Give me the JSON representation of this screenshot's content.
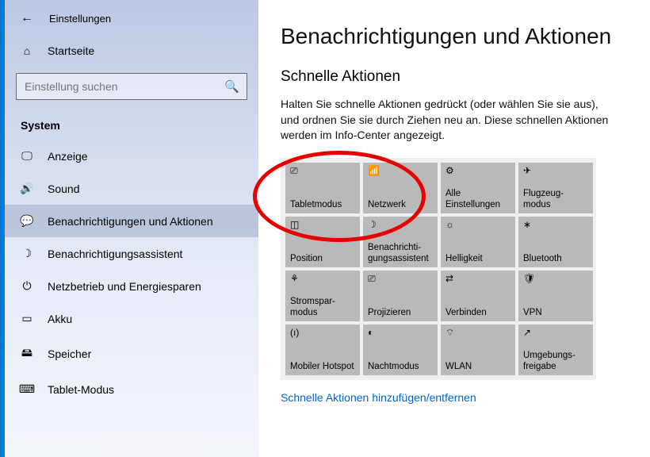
{
  "window_title": "Einstellungen",
  "home_label": "Startseite",
  "search_placeholder": "Einstellung suchen",
  "group_label": "System",
  "nav": [
    {
      "icon": "🖵",
      "label": "Anzeige"
    },
    {
      "icon": "🔊",
      "label": "Sound"
    },
    {
      "icon": "💬",
      "label": "Benachrichtigungen und Aktionen"
    },
    {
      "icon": "☽",
      "label": "Benachrichtigungsassistent"
    },
    {
      "icon": "⏻",
      "label": "Netzbetrieb und Energiesparen"
    },
    {
      "icon": "▭",
      "label": "Akku"
    },
    {
      "icon": "🖴",
      "label": "Speicher"
    },
    {
      "icon": "⌨",
      "label": "Tablet-Modus"
    }
  ],
  "page_title": "Benachrichtigungen und Aktionen",
  "section_title": "Schnelle Aktionen",
  "description": "Halten Sie schnelle Aktionen gedrückt (oder wählen Sie sie aus), und ordnen Sie sie durch Ziehen neu an. Diese schnellen Aktionen werden im Info-Center angezeigt.",
  "tiles": [
    {
      "icon": "⎚",
      "label": "Tabletmodus"
    },
    {
      "icon": "📶",
      "label": "Netzwerk"
    },
    {
      "icon": "⚙",
      "label": "Alle Einstellungen"
    },
    {
      "icon": "✈",
      "label": "Flugzeug-modus"
    },
    {
      "icon": "◫",
      "label": "Position"
    },
    {
      "icon": "☽",
      "label": "Benachrichti-gungsassistent"
    },
    {
      "icon": "☼",
      "label": "Helligkeit"
    },
    {
      "icon": "∗",
      "label": "Bluetooth"
    },
    {
      "icon": "⚘",
      "label": "Stromspar-modus"
    },
    {
      "icon": "⎚",
      "label": "Projizieren"
    },
    {
      "icon": "⇄",
      "label": "Verbinden"
    },
    {
      "icon": "🛡",
      "label": "VPN"
    },
    {
      "icon": "(ı)",
      "label": "Mobiler Hotspot"
    },
    {
      "icon": "◐",
      "label": "Nachtmodus"
    },
    {
      "icon": "⌔",
      "label": "WLAN"
    },
    {
      "icon": "↗",
      "label": "Umgebungs-freigabe"
    }
  ],
  "link_label": "Schnelle Aktionen hinzufügen/entfernen"
}
